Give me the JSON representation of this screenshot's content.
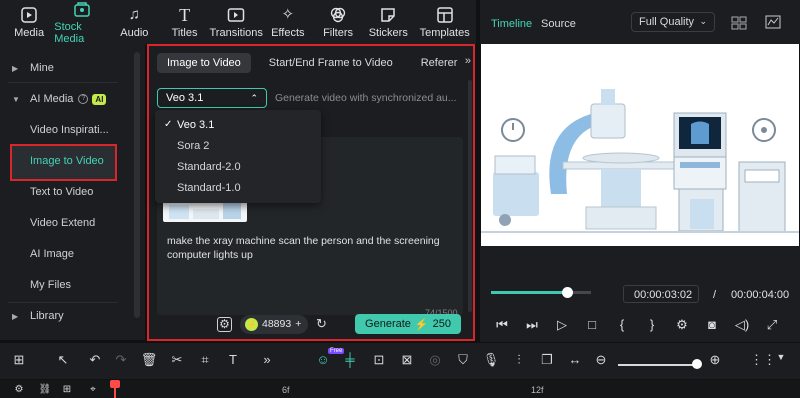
{
  "toolbar": {
    "items": [
      {
        "label": "Media",
        "icon": "media-icon"
      },
      {
        "label": "Stock Media",
        "icon": "stock-media-icon"
      },
      {
        "label": "Audio",
        "icon": "audio-icon"
      },
      {
        "label": "Titles",
        "icon": "titles-icon"
      },
      {
        "label": "Transitions",
        "icon": "transitions-icon"
      },
      {
        "label": "Effects",
        "icon": "effects-icon"
      },
      {
        "label": "Filters",
        "icon": "filters-icon"
      },
      {
        "label": "Stickers",
        "icon": "stickers-icon"
      },
      {
        "label": "Templates",
        "icon": "templates-icon"
      }
    ],
    "active": "Stock Media"
  },
  "sidebar": {
    "mine": "Mine",
    "ai_media": "AI Media",
    "ai_badge": "AI",
    "items": [
      "Video Inspirati...",
      "Image to Video",
      "Text to Video",
      "Video Extend",
      "AI Image",
      "My Files"
    ],
    "library": "Library"
  },
  "panel": {
    "tabs": [
      "Image to Video",
      "Start/End Frame to Video",
      "Referer"
    ],
    "model_selected": "Veo 3.1",
    "placeholder": "Generate video with synchronized au...",
    "models": [
      "Veo 3.1",
      "Sora 2",
      "Standard-2.0",
      "Standard-1.0"
    ],
    "prompt": "make the xray machine scan the person and the screening computer lights up",
    "counter": "74/1500",
    "credits": "48893",
    "generate_label": "Generate",
    "generate_cost": "250"
  },
  "preview": {
    "tab_timeline": "Timeline",
    "tab_source": "Source",
    "quality": "Full Quality",
    "time_current": "00:00:03:02",
    "time_separator": "/",
    "time_total": "00:00:04:00",
    "progress": 0.76
  },
  "timeline": {
    "free_badge": "Free",
    "ruler_marks": [
      "6f",
      "12f"
    ]
  },
  "colors": {
    "accent": "#45d3b8",
    "highlight_border": "#d9262b",
    "ai_badge": "#c3e94a"
  }
}
